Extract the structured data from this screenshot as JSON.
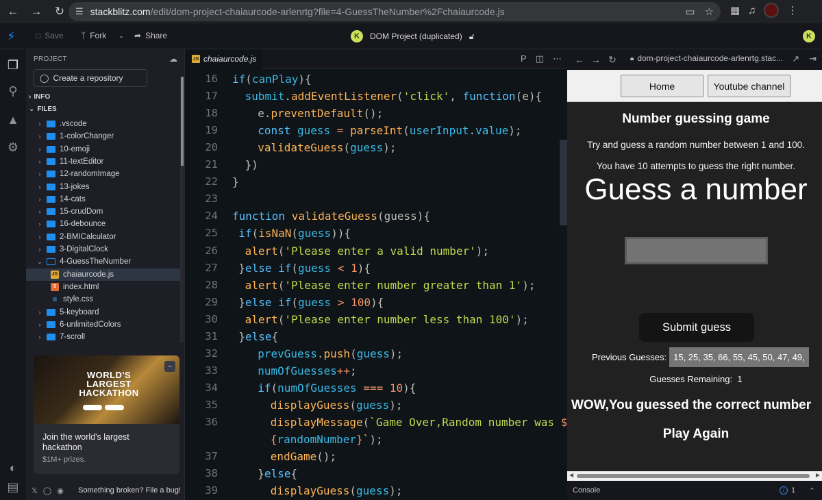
{
  "browser": {
    "url_main": "stackblitz.com",
    "url_rest": "/edit/dom-project-chaiaurcode-arlenrtg?file=4-GuessTheNumber%2Fchaiaurcode.js"
  },
  "toolbar": {
    "save_label": "Save",
    "fork_label": "Fork",
    "share_label": "Share",
    "project_title": "DOM Project (duplicated)",
    "avatar_letter": "K"
  },
  "sidebar": {
    "header": "PROJECT",
    "create_repo_label": "Create a repository",
    "info_label": "INFO",
    "files_label": "FILES",
    "tree": [
      {
        "label": ".vscode",
        "type": "folder"
      },
      {
        "label": "1-colorChanger",
        "type": "folder"
      },
      {
        "label": "10-emoji",
        "type": "folder"
      },
      {
        "label": "11-textEditor",
        "type": "folder"
      },
      {
        "label": "12-randomImage",
        "type": "folder"
      },
      {
        "label": "13-jokes",
        "type": "folder"
      },
      {
        "label": "14-cats",
        "type": "folder"
      },
      {
        "label": "15-crudDom",
        "type": "folder"
      },
      {
        "label": "16-debounce",
        "type": "folder"
      },
      {
        "label": "2-BMICalculator",
        "type": "folder"
      },
      {
        "label": "3-DigitalClock",
        "type": "folder"
      },
      {
        "label": "4-GuessTheNumber",
        "type": "folder-open"
      },
      {
        "label": "chaiaurcode.js",
        "type": "js"
      },
      {
        "label": "index.html",
        "type": "html"
      },
      {
        "label": "style.css",
        "type": "css"
      },
      {
        "label": "5-keyboard",
        "type": "folder"
      },
      {
        "label": "6-unlimitedColors",
        "type": "folder"
      },
      {
        "label": "7-scroll",
        "type": "folder"
      }
    ],
    "promo": {
      "title": "Join the world's largest hackathon",
      "subtitle": "$1M+ prizes.",
      "image_text": "WORLD'S LARGEST HACKATHON"
    },
    "footer_bug": "Something broken? File a bug!"
  },
  "editor": {
    "tab_label": "chaiaurcode.js",
    "lines": [
      {
        "n": "16",
        "indent": 0,
        "tokens": [
          [
            "kw",
            "if"
          ],
          [
            "pn",
            "("
          ],
          [
            "var",
            "canPlay"
          ],
          [
            "pn",
            "){"
          ]
        ]
      },
      {
        "n": "17",
        "indent": 1,
        "tokens": [
          [
            "var",
            "submit"
          ],
          [
            "pn",
            "."
          ],
          [
            "fn",
            "addEventListener"
          ],
          [
            "pn",
            "("
          ],
          [
            "str",
            "'click'"
          ],
          [
            "pn",
            ", "
          ],
          [
            "kw",
            "function"
          ],
          [
            "pn",
            "("
          ],
          [
            "txt",
            "e"
          ],
          [
            "pn",
            "){"
          ]
        ]
      },
      {
        "n": "18",
        "indent": 2,
        "tokens": [
          [
            "txt",
            "e"
          ],
          [
            "pn",
            "."
          ],
          [
            "fn",
            "preventDefault"
          ],
          [
            "pn",
            "();"
          ]
        ]
      },
      {
        "n": "19",
        "indent": 2,
        "tokens": [
          [
            "kw",
            "const "
          ],
          [
            "var",
            "guess"
          ],
          [
            "op",
            " = "
          ],
          [
            "fn",
            "parseInt"
          ],
          [
            "pn",
            "("
          ],
          [
            "var",
            "userInput"
          ],
          [
            "pn",
            "."
          ],
          [
            "var",
            "value"
          ],
          [
            "pn",
            ");"
          ]
        ]
      },
      {
        "n": "20",
        "indent": 2,
        "tokens": [
          [
            "fn",
            "validateGuess"
          ],
          [
            "pn",
            "("
          ],
          [
            "var",
            "guess"
          ],
          [
            "pn",
            ");"
          ]
        ]
      },
      {
        "n": "21",
        "indent": 1,
        "tokens": [
          [
            "pn",
            "})"
          ]
        ]
      },
      {
        "n": "22",
        "indent": 0,
        "tokens": [
          [
            "pn",
            "}"
          ]
        ]
      },
      {
        "n": "23",
        "indent": 0,
        "tokens": []
      },
      {
        "n": "24",
        "indent": 0,
        "tokens": [
          [
            "kw",
            "function "
          ],
          [
            "fn",
            "validateGuess"
          ],
          [
            "pn",
            "("
          ],
          [
            "txt",
            "guess"
          ],
          [
            "pn",
            "){"
          ]
        ]
      },
      {
        "n": "25",
        "indent": 0.5,
        "tokens": [
          [
            "kw",
            "if"
          ],
          [
            "pn",
            "("
          ],
          [
            "fn",
            "isNaN"
          ],
          [
            "pn",
            "("
          ],
          [
            "var",
            "guess"
          ],
          [
            "pn",
            "))"
          ],
          [
            "pn",
            "{"
          ]
        ]
      },
      {
        "n": "26",
        "indent": 1,
        "tokens": [
          [
            "fn",
            "alert"
          ],
          [
            "pn",
            "("
          ],
          [
            "str",
            "'Please enter a valid number'"
          ],
          [
            "pn",
            ");"
          ]
        ]
      },
      {
        "n": "27",
        "indent": 0.5,
        "tokens": [
          [
            "pn",
            "}"
          ],
          [
            "kw",
            "else if"
          ],
          [
            "pn",
            "("
          ],
          [
            "var",
            "guess"
          ],
          [
            "op",
            " < "
          ],
          [
            "num",
            "1"
          ],
          [
            "pn",
            "){"
          ]
        ]
      },
      {
        "n": "28",
        "indent": 1,
        "tokens": [
          [
            "fn",
            "alert"
          ],
          [
            "pn",
            "("
          ],
          [
            "str",
            "'Please enter number greater than 1'"
          ],
          [
            "pn",
            ");"
          ]
        ]
      },
      {
        "n": "29",
        "indent": 0.5,
        "tokens": [
          [
            "pn",
            "}"
          ],
          [
            "kw",
            "else if"
          ],
          [
            "pn",
            "("
          ],
          [
            "var",
            "guess"
          ],
          [
            "op",
            " > "
          ],
          [
            "num",
            "100"
          ],
          [
            "pn",
            "){"
          ]
        ]
      },
      {
        "n": "30",
        "indent": 1,
        "tokens": [
          [
            "fn",
            "alert"
          ],
          [
            "pn",
            "("
          ],
          [
            "str",
            "'Please enter number less than 100'"
          ],
          [
            "pn",
            ");"
          ]
        ]
      },
      {
        "n": "31",
        "indent": 0.5,
        "tokens": [
          [
            "pn",
            "}"
          ],
          [
            "kw",
            "else"
          ],
          [
            "pn",
            "{"
          ]
        ]
      },
      {
        "n": "32",
        "indent": 2,
        "tokens": [
          [
            "var",
            "prevGuess"
          ],
          [
            "pn",
            "."
          ],
          [
            "fn",
            "push"
          ],
          [
            "pn",
            "("
          ],
          [
            "var",
            "guess"
          ],
          [
            "pn",
            ");"
          ]
        ]
      },
      {
        "n": "33",
        "indent": 2,
        "tokens": [
          [
            "var",
            "numOfGuesses"
          ],
          [
            "op",
            "++"
          ],
          [
            "pn",
            ";"
          ]
        ]
      },
      {
        "n": "34",
        "indent": 2,
        "tokens": [
          [
            "kw",
            "if"
          ],
          [
            "pn",
            "("
          ],
          [
            "var",
            "numOfGuesses"
          ],
          [
            "op",
            " === "
          ],
          [
            "num",
            "10"
          ],
          [
            "pn",
            "){"
          ]
        ]
      },
      {
        "n": "35",
        "indent": 3,
        "tokens": [
          [
            "fn",
            "displayGuess"
          ],
          [
            "pn",
            "("
          ],
          [
            "var",
            "guess"
          ],
          [
            "pn",
            ");"
          ]
        ]
      },
      {
        "n": "36",
        "indent": 3,
        "tokens": [
          [
            "fn",
            "displayMessage"
          ],
          [
            "pn",
            "("
          ],
          [
            "str",
            "`Game Over,Random number was "
          ],
          [
            "op",
            "$"
          ]
        ]
      },
      {
        "n": "",
        "indent": 3,
        "tokens": [
          [
            "op",
            "{"
          ],
          [
            "var",
            "randomNumber"
          ],
          [
            "op",
            "}"
          ],
          [
            "str",
            "`"
          ],
          [
            "pn",
            ");"
          ]
        ]
      },
      {
        "n": "37",
        "indent": 3,
        "tokens": [
          [
            "fn",
            "endGame"
          ],
          [
            "pn",
            "();"
          ]
        ]
      },
      {
        "n": "38",
        "indent": 2,
        "tokens": [
          [
            "pn",
            "}"
          ],
          [
            "kw",
            "else"
          ],
          [
            "pn",
            "{"
          ]
        ]
      },
      {
        "n": "39",
        "indent": 3,
        "tokens": [
          [
            "fn",
            "displayGuess"
          ],
          [
            "pn",
            "("
          ],
          [
            "var",
            "guess"
          ],
          [
            "pn",
            ");"
          ]
        ]
      }
    ]
  },
  "preview": {
    "url": "dom-project-chaiaurcode-arlenrtg.stac...",
    "home_label": "Home",
    "youtube_label": "Youtube channel",
    "heading": "Number guessing game",
    "intro1": "Try and guess a random number between 1 and 100.",
    "intro2": "You have 10 attempts to guess the right number.",
    "guess_heading": "Guess a number",
    "submit_label": "Submit guess",
    "prev_label": "Previous Guesses:",
    "prev_values": "15, 25, 35, 66, 55, 45, 50, 47, 49,",
    "remaining_label": "Guesses Remaining:",
    "remaining_value": "1",
    "win_message": "WOW,You guessed the correct number",
    "play_again": "Play Again",
    "console_label": "Console",
    "console_info_count": "1"
  },
  "colors": {
    "accent": "#1389fd",
    "editor_bg": "#0f1419",
    "keyword": "#59c2ff",
    "function": "#ffb454",
    "string": "#c2d94c",
    "number": "#f29668"
  }
}
